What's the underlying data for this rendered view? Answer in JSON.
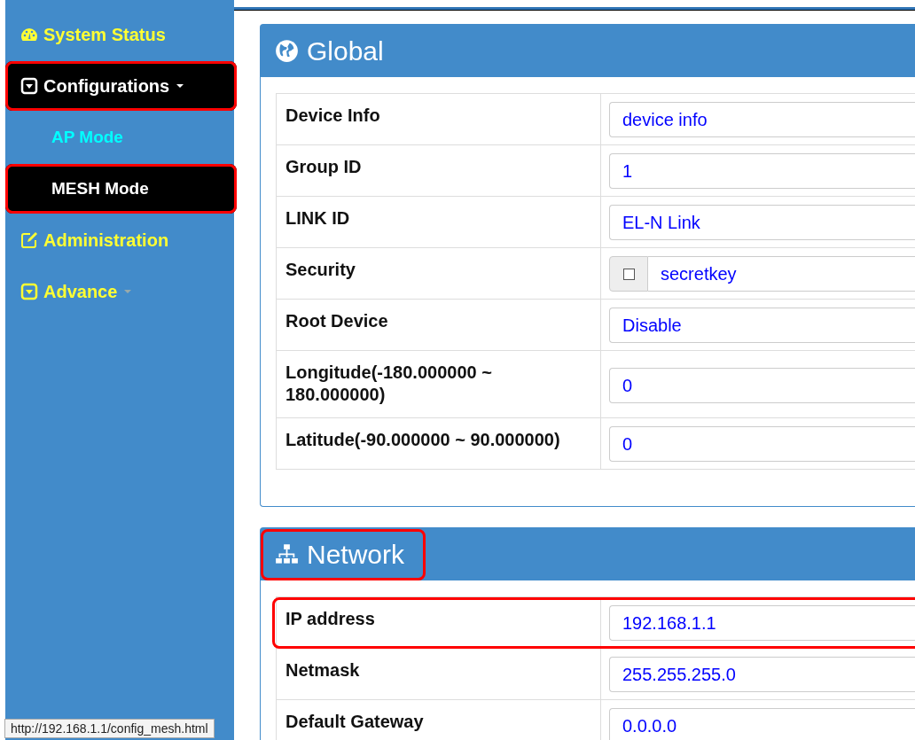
{
  "sidebar": {
    "items": [
      {
        "label": "System Status",
        "kind": "main",
        "selected": false,
        "highlighted": false,
        "dropdown": false
      },
      {
        "label": "Configurations",
        "kind": "main",
        "selected": true,
        "highlighted": true,
        "dropdown": true
      },
      {
        "label": "AP Mode",
        "kind": "sub",
        "selected": false,
        "highlighted": false,
        "dropdown": false
      },
      {
        "label": "MESH Mode",
        "kind": "sub",
        "selected": true,
        "highlighted": true,
        "dropdown": false
      },
      {
        "label": "Administration",
        "kind": "main",
        "selected": false,
        "highlighted": false,
        "dropdown": false
      },
      {
        "label": "Advance",
        "kind": "main",
        "selected": false,
        "highlighted": false,
        "dropdown": true
      }
    ]
  },
  "panels": [
    {
      "title": "Global",
      "highlighted": false,
      "rows": [
        {
          "label": "Device Info",
          "value": "device info",
          "kind": "text",
          "highlighted": false
        },
        {
          "label": "Group ID",
          "value": "1",
          "kind": "text",
          "highlighted": false
        },
        {
          "label": "LINK ID",
          "value": "EL-N Link",
          "kind": "text",
          "highlighted": false
        },
        {
          "label": "Security",
          "value": "secretkey",
          "kind": "checkbox_text",
          "checked": false,
          "highlighted": false
        },
        {
          "label": "Root Device",
          "value": "Disable",
          "kind": "text",
          "highlighted": false
        },
        {
          "label": "Longitude(-180.000000 ~ 180.000000)",
          "value": "0",
          "kind": "text",
          "highlighted": false
        },
        {
          "label": "Latitude(-90.000000 ~ 90.000000)",
          "value": "0",
          "kind": "text",
          "highlighted": false
        }
      ]
    },
    {
      "title": "Network",
      "highlighted": true,
      "rows": [
        {
          "label": "IP address",
          "value": "192.168.1.1",
          "kind": "text",
          "highlighted": true
        },
        {
          "label": "Netmask",
          "value": "255.255.255.0",
          "kind": "text",
          "highlighted": false
        },
        {
          "label": "Default Gateway",
          "value": "0.0.0.0",
          "kind": "text",
          "highlighted": false
        }
      ]
    }
  ],
  "status_bar": {
    "url": "http://192.168.1.1/config_mesh.html"
  }
}
